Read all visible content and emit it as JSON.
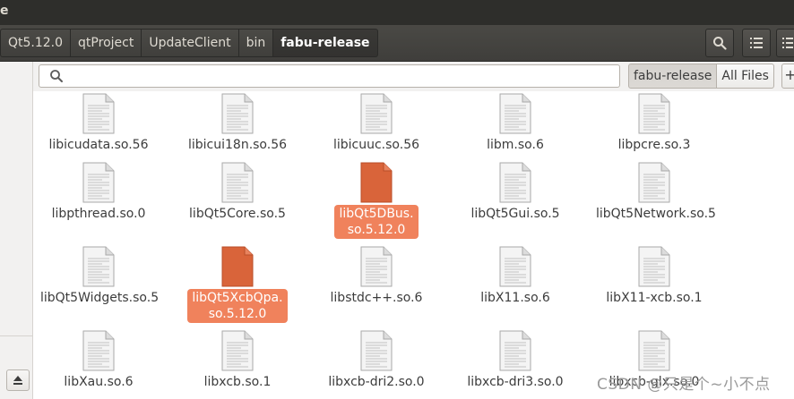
{
  "window": {
    "title_fragment": "e"
  },
  "breadcrumbs": [
    "Qt5.12.0",
    "qtProject",
    "UpdateClient",
    "bin",
    "fabu-release"
  ],
  "header_buttons": {
    "search": "search-icon",
    "view": "list-view-icon",
    "menu": "grid-view-icon"
  },
  "search": {
    "value": "",
    "placeholder": ""
  },
  "scope": {
    "current": "fabu-release",
    "all": "All Files",
    "add": "+"
  },
  "files": [
    {
      "name": "libicudata.so.56",
      "selected": false
    },
    {
      "name": "libicui18n.so.56",
      "selected": false
    },
    {
      "name": "libicuuc.so.56",
      "selected": false
    },
    {
      "name": "libm.so.6",
      "selected": false
    },
    {
      "name": "libpcre.so.3",
      "selected": false
    },
    {
      "name": "libpthread.so.0",
      "selected": false
    },
    {
      "name": "libQt5Core.so.5",
      "selected": false
    },
    {
      "name": "libQt5DBus.\nso.5.12.0",
      "selected": true
    },
    {
      "name": "libQt5Gui.so.5",
      "selected": false
    },
    {
      "name": "libQt5Network.so.5",
      "selected": false
    },
    {
      "name": "libQt5Widgets.so.5",
      "selected": false
    },
    {
      "name": "libQt5XcbQpa.\nso.5.12.0",
      "selected": true
    },
    {
      "name": "libstdc++.so.6",
      "selected": false
    },
    {
      "name": "libX11.so.6",
      "selected": false
    },
    {
      "name": "libX11-xcb.so.1",
      "selected": false
    },
    {
      "name": "libXau.so.6",
      "selected": false
    },
    {
      "name": "libxcb.so.1",
      "selected": false
    },
    {
      "name": "libxcb-dri2.so.0",
      "selected": false
    },
    {
      "name": "libxcb-dri3.so.0",
      "selected": false
    },
    {
      "name": "libxcb-glx.so.0",
      "selected": false
    }
  ],
  "colors": {
    "selection": "#f0825c",
    "selected_icon": "#d9643a",
    "header": "#3f3e3b"
  },
  "watermark": "CSDN @只是个~小不点"
}
